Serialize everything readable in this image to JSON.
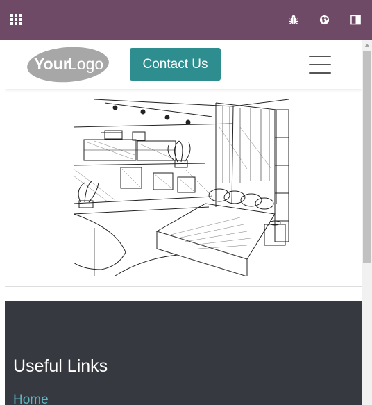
{
  "topbar": {
    "icons": [
      "apps-grid-icon",
      "bug-icon",
      "globe-icon",
      "panel-toggle-icon"
    ],
    "background": "#6e4a66"
  },
  "header": {
    "logo_text_bold": "Your",
    "logo_text_light": "Logo",
    "contact_label": "Contact Us",
    "menu_icon": "hamburger-icon",
    "accent": "#2e8e8f"
  },
  "hero": {
    "image": "bedroom-sketch-illustration"
  },
  "footer": {
    "title": "Useful Links",
    "links": [
      "Home"
    ],
    "background": "#363a40",
    "link_color": "#5db6c4"
  }
}
